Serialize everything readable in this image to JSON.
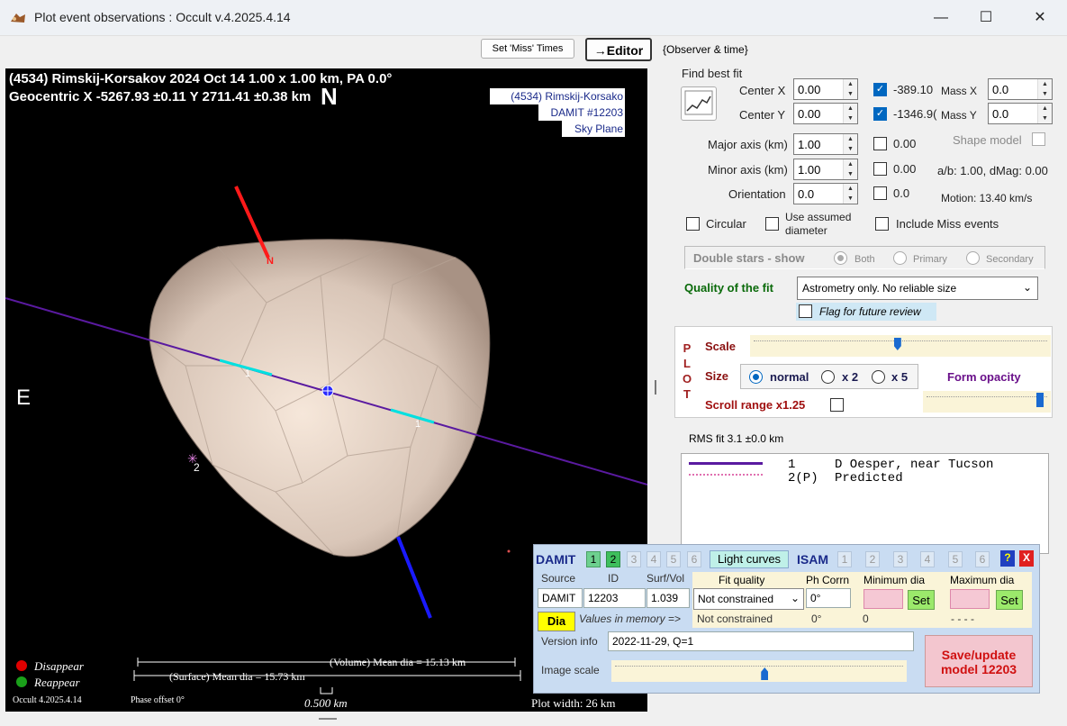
{
  "window": {
    "title": "Plot event observations : Occult v.4.2025.4.14",
    "min": "—",
    "max": "☐",
    "close": "✕"
  },
  "toolbar": {
    "set_miss": "Set 'Miss' Times",
    "editor": "→Editor",
    "observer_time": "{Observer & time}"
  },
  "plot": {
    "header1": "(4534) Rimskij-Korsakov  2024 Oct 14  1.00 x 1.00 km, PA 0.0°",
    "header2": "Geocentric X  -5267.93 ±0.11  Y 2711.41 ±0.38 km",
    "north": "N",
    "east": "E",
    "pole_label": "N",
    "badge": [
      "(4534) Rimskij-Korsako",
      "DAMIT #12203",
      "Sky Plane"
    ],
    "chord_labels": [
      "1",
      "1",
      "2"
    ],
    "disappear": "Disappear",
    "reappear": "Reappear",
    "volume_dia": "(Volume) Mean dia = 15.13 km",
    "surface_dia": "(Surface) Mean dia = 15.73 km",
    "scale": "0.500 km",
    "version": "Occult 4.2025.4.14",
    "phase": "Phase offset 0°",
    "width": "Plot width: 26 km",
    "colors": {
      "disappear": "#e00000",
      "reappear": "#1aa01a",
      "chord": "#5a1aa0",
      "shape": "#e8d8cc"
    }
  },
  "fit": {
    "title": "Find best fit",
    "center_x": {
      "label": "Center X",
      "value": "0.00",
      "checked": true,
      "result": "-389.10",
      "mass_label": "Mass X",
      "mass": "0.0"
    },
    "center_y": {
      "label": "Center Y",
      "value": "0.00",
      "checked": true,
      "result": "-1346.9(",
      "mass_label": "Mass Y",
      "mass": "0.0"
    },
    "major": {
      "label": "Major axis (km)",
      "value": "1.00",
      "result": "0.00"
    },
    "minor": {
      "label": "Minor axis (km)",
      "value": "1.00",
      "result": "0.00"
    },
    "orient": {
      "label": "Orientation",
      "value": "0.0",
      "result": "0.0"
    },
    "shape_model": "Shape model",
    "ab": "a/b: 1.00, dMag: 0.00",
    "motion": "Motion: 13.40 km/s",
    "circular": "Circular",
    "assumed": "Use assumed diameter",
    "include_miss": "Include Miss events",
    "double_title": "Double stars - show",
    "both": "Both",
    "primary": "Primary",
    "secondary": "Secondary",
    "quality_label": "Quality of the fit",
    "quality_value": "Astrometry only. No reliable size",
    "flag": "Flag for future review"
  },
  "plotctl": {
    "side": [
      "P",
      "L",
      "O",
      "T"
    ],
    "scale": "Scale",
    "size": "Size",
    "normal": "normal",
    "x2": "x 2",
    "x5": "x 5",
    "form_opacity": "Form opacity",
    "scroll": "Scroll range x1.25",
    "scale_level": 0.49,
    "opacity_level": 0.97
  },
  "rms": "RMS fit 3.1 ±0.0 km",
  "observers": [
    {
      "num": "1",
      "name": "D Oesper, near Tucson"
    },
    {
      "num": "2(P)",
      "name": "Predicted"
    }
  ],
  "damit": {
    "title": "DAMIT",
    "nums": [
      "1",
      "2",
      "3",
      "4",
      "5",
      "6"
    ],
    "light_curves": "Light curves",
    "isam": "ISAM",
    "isam_nums": [
      "1",
      "2",
      "3",
      "4",
      "5",
      "6"
    ],
    "help": "?",
    "close": "X",
    "source_h": "Source",
    "id_h": "ID",
    "surf_h": "Surf/Vol",
    "fitq_h": "Fit quality",
    "phcorr_h": "Ph Corrn",
    "min_h": "Minimum dia",
    "max_h": "Maximum dia",
    "source": "DAMIT",
    "id": "12203",
    "surf": "1.039",
    "fitq": "Not constrained",
    "phcorr": "0°",
    "dia": "Dia",
    "values_mem": "Values in memory =>",
    "mem_fitq": "Not constrained",
    "mem_ph": "0°",
    "mem_min": "0",
    "mem_max": "- - - -",
    "set": "Set",
    "version_label": "Version info",
    "version": "2022-11-29, Q=1",
    "image_scale": "Image scale",
    "image_scale_level": 0.52,
    "save": "Save/update model  12203"
  }
}
